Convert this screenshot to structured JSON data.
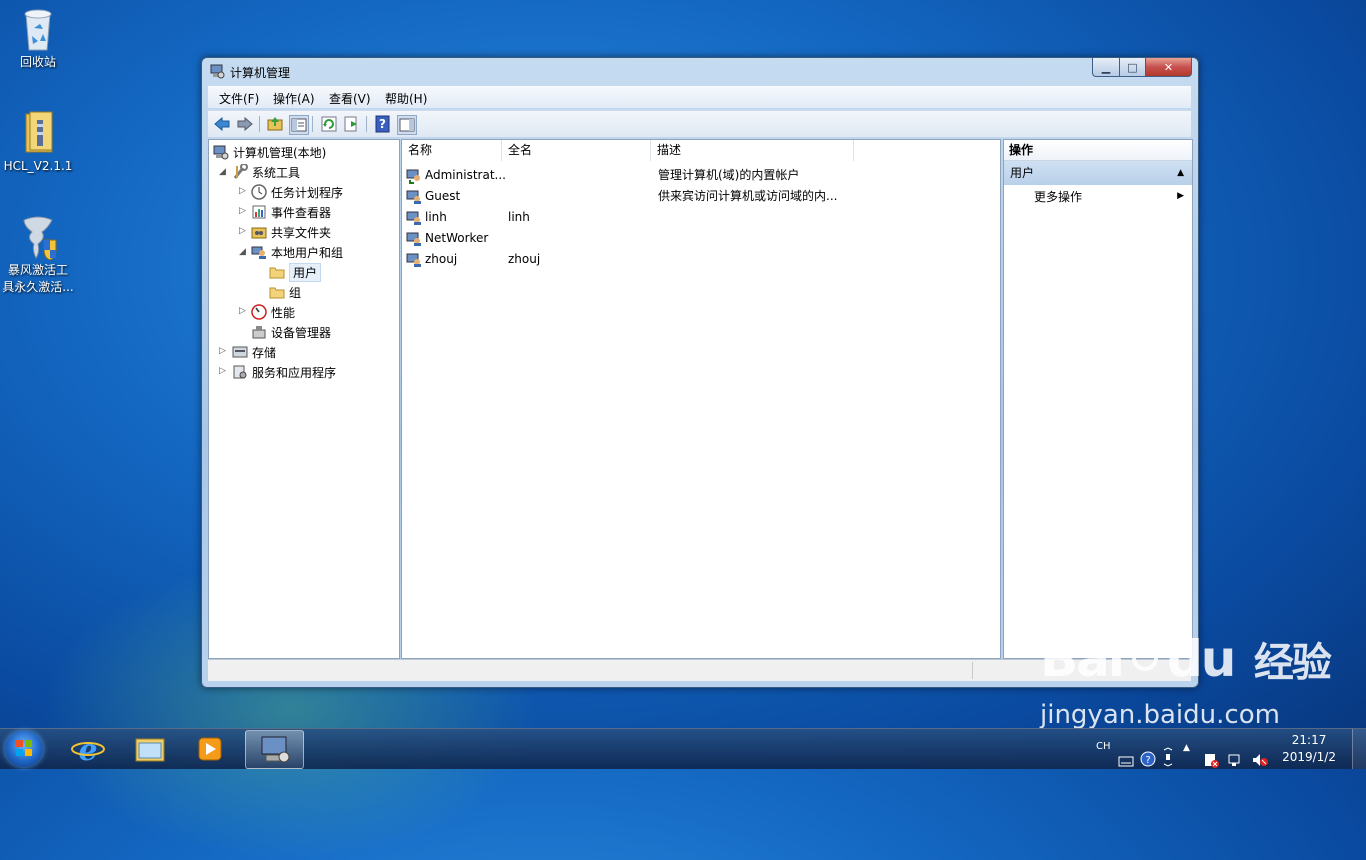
{
  "desktop": {
    "icons": [
      {
        "label": "回收站"
      },
      {
        "label": "HCL_V2.1.1"
      },
      {
        "label_line1": "暴风激活工",
        "label_line2": "具永久激活..."
      }
    ]
  },
  "window": {
    "title": "计算机管理",
    "menu": [
      "文件(F)",
      "操作(A)",
      "查看(V)",
      "帮助(H)"
    ],
    "tree": {
      "root": "计算机管理(本地)",
      "system_tools": "系统工具",
      "task_scheduler": "任务计划程序",
      "event_viewer": "事件查看器",
      "shared_folders": "共享文件夹",
      "local_users_groups": "本地用户和组",
      "users": "用户",
      "groups": "组",
      "performance": "性能",
      "device_manager": "设备管理器",
      "storage": "存储",
      "services_apps": "服务和应用程序"
    },
    "columns": {
      "name": "名称",
      "fullname": "全名",
      "description": "描述"
    },
    "users": [
      {
        "name": "Administrat...",
        "fullname": "",
        "description": "管理计算机(域)的内置帐户"
      },
      {
        "name": "Guest",
        "fullname": "",
        "description": "供来宾访问计算机或访问域的内..."
      },
      {
        "name": "linh",
        "fullname": "linh",
        "description": ""
      },
      {
        "name": "NetWorker",
        "fullname": "",
        "description": ""
      },
      {
        "name": "zhouj",
        "fullname": "zhouj",
        "description": ""
      }
    ],
    "actions": {
      "header": "操作",
      "section": "用户",
      "more": "更多操作"
    }
  },
  "taskbar": {
    "lang": "CH",
    "time": "21:17",
    "date": "2019/1/2"
  },
  "watermark": {
    "brand_latin": "Bai",
    "brand_latin2": "du",
    "brand_cn": "经验",
    "url": "jingyan.baidu.com"
  }
}
